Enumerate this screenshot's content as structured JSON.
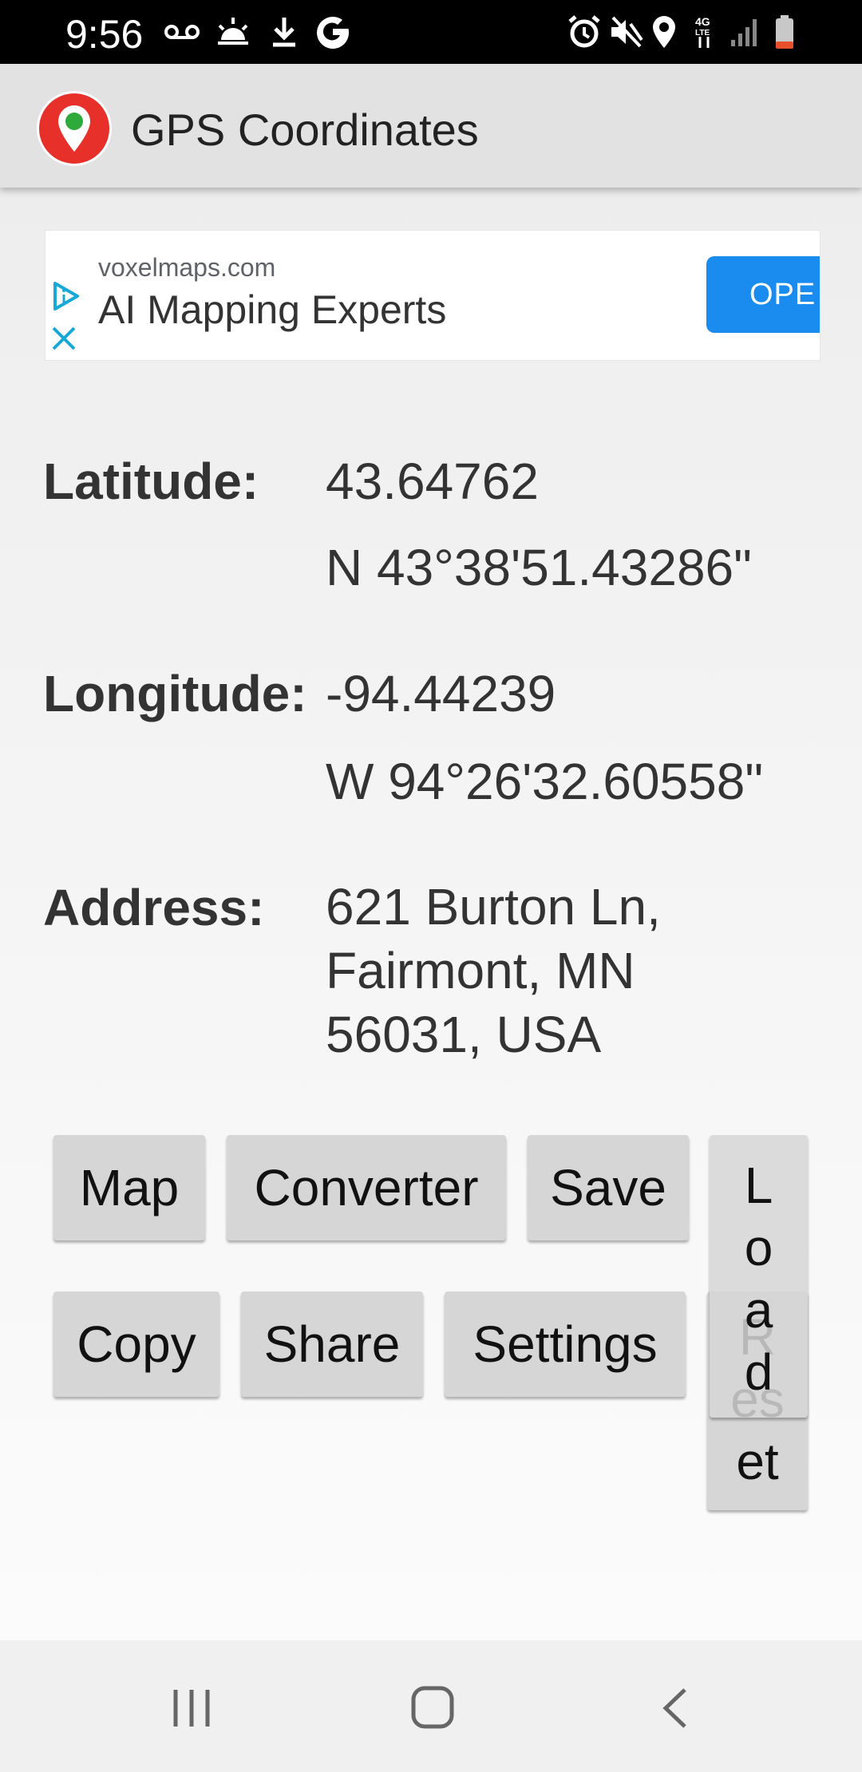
{
  "status_bar": {
    "time": "9:56",
    "left_icons": [
      "voicemail-icon",
      "weather-icon",
      "download-icon",
      "google-icon"
    ],
    "right_icons": [
      "alarm-icon",
      "mute-icon",
      "location-icon",
      "4g-lte-icon",
      "signal-icon",
      "battery-icon"
    ]
  },
  "app_bar": {
    "title": "GPS Coordinates",
    "logo_icon": "map-pin-icon"
  },
  "ad": {
    "domain": "voxelmaps.com",
    "headline": "AI Mapping Experts",
    "button": "OPE",
    "accent": "#1a8cf0"
  },
  "info": {
    "latitude_label": "Latitude:",
    "latitude_decimal": "43.64762",
    "latitude_dms": "N 43°38'51.43286\"",
    "longitude_label": "Longitude:",
    "longitude_decimal": "-94.44239",
    "longitude_dms": "W 94°26'32.60558\"",
    "address_label": "Address:",
    "address_line1": "621 Burton Ln,",
    "address_line2": "Fairmont, MN",
    "address_line3": "56031, USA"
  },
  "buttons": {
    "map": "Map",
    "converter": "Converter",
    "save": "Save",
    "load": "Load",
    "copy": "Copy",
    "share": "Share",
    "settings": "Settings",
    "reset": "Reset"
  },
  "nav_bar": {
    "icons": [
      "recent-apps-icon",
      "home-icon",
      "back-icon"
    ]
  }
}
